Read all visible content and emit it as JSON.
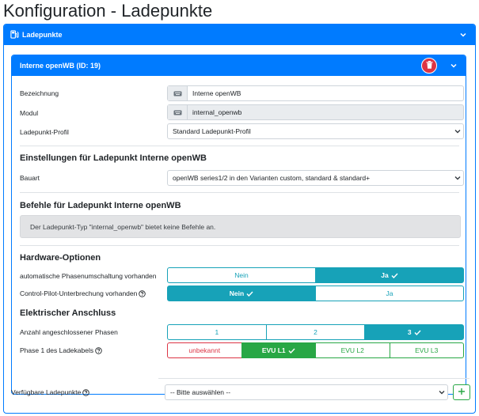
{
  "page": {
    "title": "Konfiguration - Ladepunkte"
  },
  "outer_card": {
    "title": "Ladepunkte"
  },
  "inner_card": {
    "title": "Interne openWB (ID: 19)"
  },
  "fields": {
    "bezeichnung": {
      "label": "Bezeichnung",
      "value": "Interne openWB"
    },
    "modul": {
      "label": "Modul",
      "value": "internal_openwb"
    },
    "profil": {
      "label": "Ladepunkt-Profil",
      "value": "Standard Ladepunkt-Profil"
    }
  },
  "einstellungen": {
    "title": "Einstellungen für Ladepunkt Interne openWB",
    "bauart": {
      "label": "Bauart",
      "value": "openWB series1/2 in den Varianten custom, standard & standard+"
    }
  },
  "befehle": {
    "title": "Befehle für Ladepunkt Interne openWB",
    "message": "Der Ladepunkt-Typ \"internal_openwb\" bietet keine Befehle an."
  },
  "hardware": {
    "title": "Hardware-Optionen",
    "phasenumschaltung": {
      "label": "automatische Phasenumschaltung vorhanden",
      "options": [
        "Nein",
        "Ja"
      ],
      "selected": "Ja"
    },
    "cp_unterbrechung": {
      "label": "Control-Pilot-Unterbrechung vorhanden",
      "options": [
        "Nein",
        "Ja"
      ],
      "selected": "Nein"
    }
  },
  "elektrisch": {
    "title": "Elektrischer Anschluss",
    "phasen": {
      "label": "Anzahl angeschlossener Phasen",
      "options": [
        "1",
        "2",
        "3"
      ],
      "selected": "3"
    },
    "phase1": {
      "label": "Phase 1 des Ladekabels",
      "options": [
        "unbekannt",
        "EVU L1",
        "EVU L2",
        "EVU L3"
      ],
      "selected": "EVU L1"
    }
  },
  "available": {
    "label": "Verfügbare Ladepunkte",
    "placeholder": "-- Bitte auswählen --"
  },
  "colors": {
    "primary": "#007bff",
    "info": "#17a2b8",
    "danger": "#dc3545",
    "success": "#28a745"
  }
}
